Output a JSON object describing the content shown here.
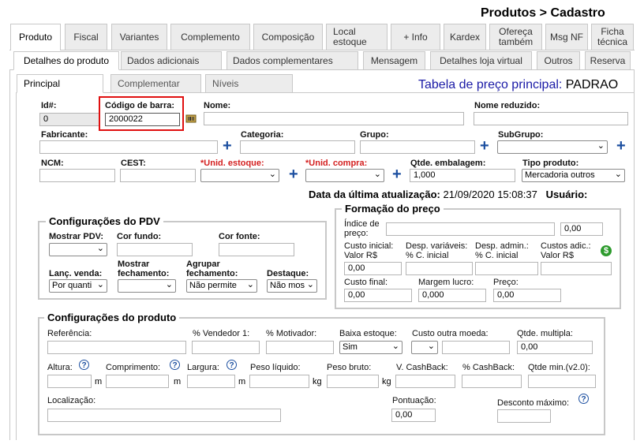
{
  "page_title": "Produtos > Cadastro",
  "main_tabs": [
    {
      "label": "Produto"
    },
    {
      "label": "Fiscal"
    },
    {
      "label": "Variantes"
    },
    {
      "label": "Complemento"
    },
    {
      "label": "Composição"
    },
    {
      "label": "Local estoque"
    },
    {
      "label": "+ Info"
    },
    {
      "label": "Kardex"
    },
    {
      "label": "Ofereça também"
    },
    {
      "label": "Msg NF"
    },
    {
      "label": "Ficha técnica"
    }
  ],
  "sub_tabs": [
    {
      "label": "Detalhes do produto"
    },
    {
      "label": "Dados adicionais"
    },
    {
      "label": "Dados complementares"
    },
    {
      "label": "Mensagem"
    },
    {
      "label": "Detalhes loja virtual"
    },
    {
      "label": "Outros"
    },
    {
      "label": "Reserva"
    }
  ],
  "inner_tabs": [
    {
      "label": "Principal"
    },
    {
      "label": "Complementar"
    },
    {
      "label": "Níveis"
    }
  ],
  "price_table": {
    "label": "Tabela de preço principal:",
    "value": "PADRAO"
  },
  "fields": {
    "id": {
      "label": "Id#:",
      "value": "0"
    },
    "barcode": {
      "label": "Código de barra:",
      "value": "2000022"
    },
    "nome": {
      "label": "Nome:",
      "value": ""
    },
    "nome_reduzido": {
      "label": "Nome reduzido:",
      "value": ""
    },
    "fabricante": {
      "label": "Fabricante:",
      "value": ""
    },
    "categoria": {
      "label": "Categoria:",
      "value": ""
    },
    "grupo": {
      "label": "Grupo:",
      "value": ""
    },
    "subgrupo": {
      "label": "SubGrupo:",
      "value": ""
    },
    "ncm": {
      "label": "NCM:",
      "value": ""
    },
    "cest": {
      "label": "CEST:",
      "value": ""
    },
    "unid_estoque": {
      "label": "*Unid. estoque:",
      "value": ""
    },
    "unid_compra": {
      "label": "*Unid. compra:",
      "value": ""
    },
    "qtde_embalagem": {
      "label": "Qtde. embalagem:",
      "value": "1,000"
    },
    "tipo_produto": {
      "label": "Tipo produto:",
      "value": "Mercadoria outros"
    }
  },
  "last_update": {
    "label": "Data da última atualização:",
    "value": "21/09/2020 15:08:37",
    "user_label": "Usuário:"
  },
  "pdv": {
    "legend": "Configurações do PDV",
    "mostrar_pdv": {
      "label": "Mostrar PDV:",
      "value": ""
    },
    "cor_fundo": {
      "label": "Cor fundo:",
      "value": ""
    },
    "cor_fonte": {
      "label": "Cor fonte:",
      "value": ""
    },
    "lanc_venda": {
      "label": "Lanç. venda:",
      "value": "Por quanti"
    },
    "mostrar_fechamento": {
      "label": "Mostrar fechamento:",
      "value": ""
    },
    "agrupar_fechamento": {
      "label": "Agrupar fechamento:",
      "value": "Não permite"
    },
    "destaque": {
      "label": "Destaque:",
      "value": "Não mos"
    }
  },
  "preco": {
    "legend": "Formação do preço",
    "indice": {
      "label": "Índice de preço:",
      "value": "",
      "value2": "0,00"
    },
    "custo_inicial": {
      "label1": "Custo inicial:",
      "label2": "Valor R$",
      "value": "0,00"
    },
    "desp_variaveis": {
      "label1": "Desp. variáveis:",
      "label2": "% C. inicial",
      "value": ""
    },
    "desp_admin": {
      "label1": "Desp. admin.:",
      "label2": "% C. inicial",
      "value": ""
    },
    "custos_adic": {
      "label1": "Custos adic.:",
      "label2": "Valor R$",
      "value": ""
    },
    "custo_final": {
      "label": "Custo final:",
      "value": "0,00"
    },
    "margem_lucro": {
      "label": "Margem lucro:",
      "value": "0,000"
    },
    "preco": {
      "label": "Preço:",
      "value": "0,00"
    }
  },
  "produto_cfg": {
    "legend": "Configurações do produto",
    "referencia": {
      "label": "Referência:",
      "value": ""
    },
    "vendedor1": {
      "label": "% Vendedor 1:",
      "value": ""
    },
    "motivador": {
      "label": "% Motivador:",
      "value": ""
    },
    "baixa_estoque": {
      "label": "Baixa estoque:",
      "value": "Sim"
    },
    "custo_outra_moeda": {
      "label": "Custo outra moeda:",
      "value": ""
    },
    "qtde_multipla": {
      "label": "Qtde. multipla:",
      "value": "0,00"
    },
    "altura": {
      "label": "Altura:",
      "unit": "m"
    },
    "comprimento": {
      "label": "Comprimento:",
      "unit": "m"
    },
    "largura": {
      "label": "Largura:",
      "unit": "m"
    },
    "peso_liquido": {
      "label": "Peso líquido:",
      "unit": "kg"
    },
    "peso_bruto": {
      "label": "Peso bruto:",
      "unit": "kg"
    },
    "v_cashback": {
      "label": "V. CashBack:",
      "value": ""
    },
    "p_cashback": {
      "label": "% CashBack:",
      "value": ""
    },
    "qtde_min": {
      "label": "Qtde min.(v2.0):",
      "value": ""
    },
    "localizacao": {
      "label": "Localização:",
      "value": ""
    },
    "pontuacao": {
      "label": "Pontuação:",
      "value": "0,00"
    },
    "desconto_maximo": {
      "label": "Desconto máximo:",
      "value": ""
    }
  },
  "icons": {
    "help": "?",
    "plus": "+",
    "dollar": "$",
    "chevron": "⌄"
  }
}
